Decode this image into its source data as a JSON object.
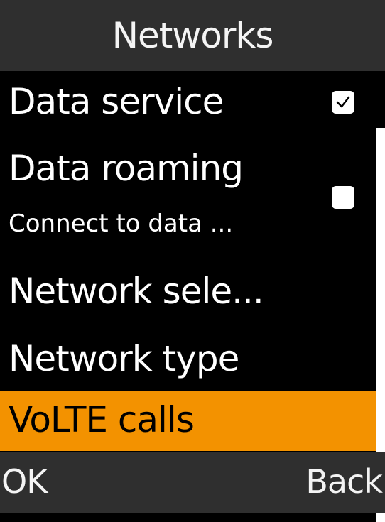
{
  "header": {
    "title": "Networks"
  },
  "menu": {
    "items": [
      {
        "label": "Data service",
        "control": "checkbox",
        "checked": true
      },
      {
        "label": "Data roaming",
        "sublabel": "Connect to data ...",
        "control": "checkbox",
        "checked": false
      },
      {
        "label": "Network sele..."
      },
      {
        "label": "Network type"
      },
      {
        "label": "VoLTE calls",
        "selected": true
      }
    ]
  },
  "softkeys": {
    "left": "OK",
    "right": "Back"
  },
  "colors": {
    "accent": "#f39200",
    "bar_background": "#2f2f2f",
    "list_background": "#000000",
    "text": "#ffffff"
  },
  "icons": {
    "checked": "checkbox-checked-icon",
    "unchecked": "checkbox-unchecked-icon"
  }
}
